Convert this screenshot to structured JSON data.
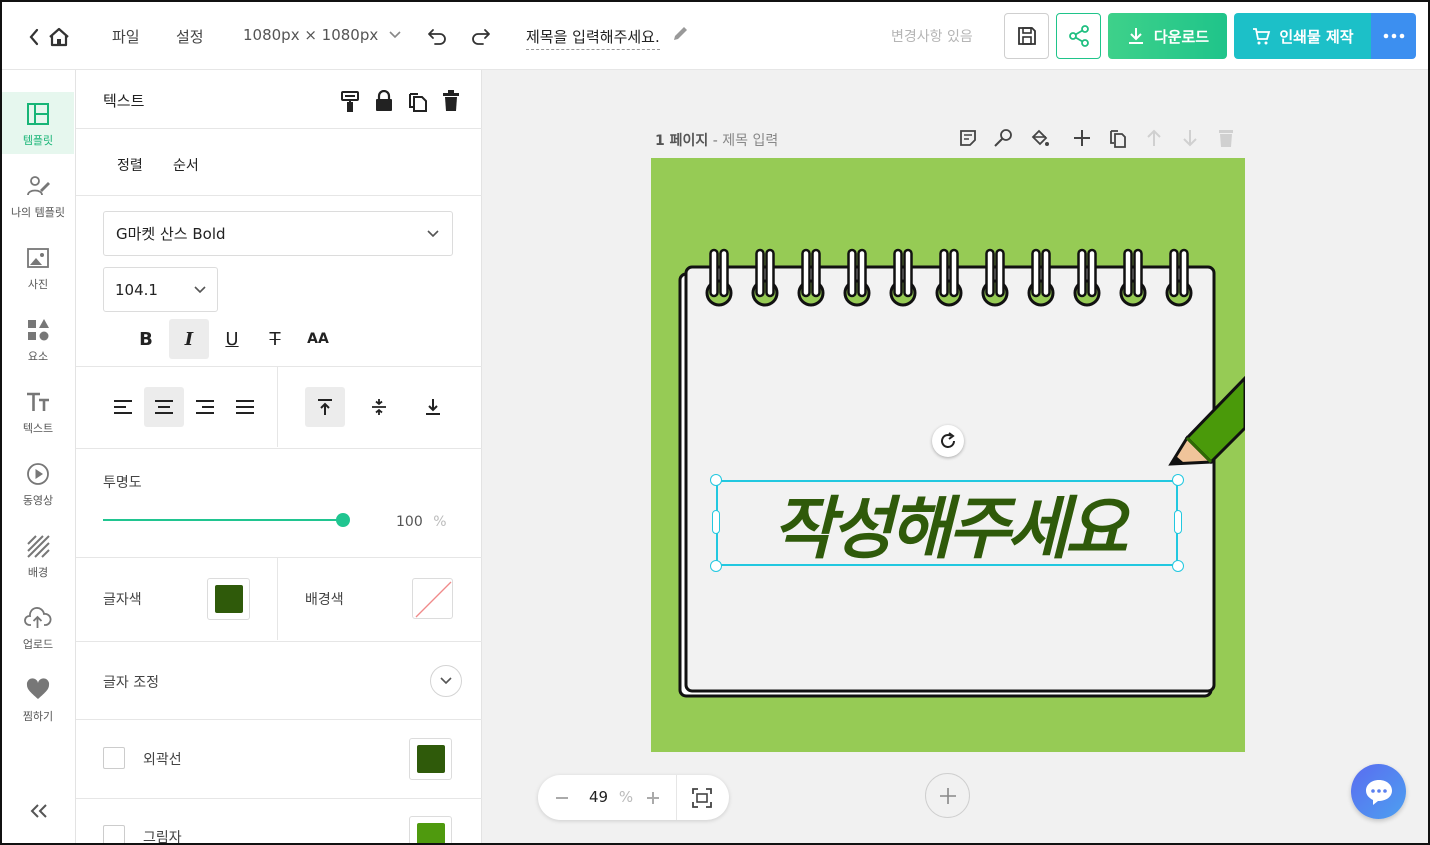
{
  "topbar": {
    "menu_file": "파일",
    "menu_settings": "설정",
    "size": "1080px × 1080px",
    "title": "제목을 입력해주세요.",
    "status": "변경사항 있음",
    "download_label": "다운로드",
    "print_label": "인쇄물 제작"
  },
  "nav": {
    "items": [
      {
        "label": "템플릿",
        "icon": "layout-icon"
      },
      {
        "label": "나의 템플릿",
        "icon": "my-template-icon"
      },
      {
        "label": "사진",
        "icon": "image-icon"
      },
      {
        "label": "요소",
        "icon": "elements-icon"
      },
      {
        "label": "텍스트",
        "icon": "text-icon"
      },
      {
        "label": "동영상",
        "icon": "video-icon"
      },
      {
        "label": "배경",
        "icon": "background-icon"
      },
      {
        "label": "업로드",
        "icon": "upload-icon"
      },
      {
        "label": "찜하기",
        "icon": "heart-icon"
      }
    ]
  },
  "panel": {
    "title": "텍스트",
    "tab_align": "정렬",
    "tab_order": "순서",
    "font_family": "G마켓 산스 Bold",
    "font_size": "104.1",
    "bold_glyph": "B",
    "italic_glyph": "I",
    "underline_glyph": "U",
    "strike_glyph": "T",
    "case_glyph": "AA",
    "opacity_label": "투명도",
    "opacity_value": "100",
    "opacity_unit": "%",
    "text_color_label": "글자색",
    "text_color": "#2f5a0a",
    "bg_color_label": "배경색",
    "spacing_label": "글자 조정",
    "outline_label": "외곽선",
    "outline_color": "#2f5a0a",
    "shadow_label": "그림자",
    "shadow_color": "#4f9a0e"
  },
  "canvas": {
    "page_label": "1 페이지 - 제목 입력",
    "page_num": "1 페이지",
    "page_title": "제목 입력",
    "headline": "작성해주세요",
    "bg_color": "#96cb55",
    "headline_color": "#2f5a0a"
  },
  "zoom": {
    "value": "49",
    "unit": "%"
  },
  "colors": {
    "green_grad_start": "#3ed18a",
    "green_grad_end": "#1fc48a",
    "teal": "#1cc0c8",
    "blue": "#3c8ff0"
  }
}
